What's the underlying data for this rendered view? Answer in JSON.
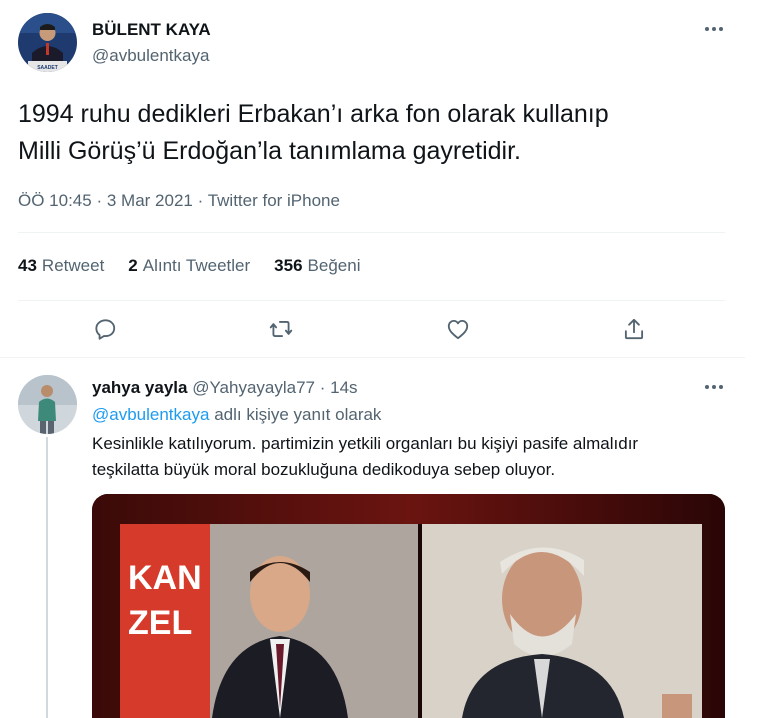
{
  "main_tweet": {
    "author_name": "BÜLENT KAYA",
    "author_handle": "@avbulentkaya",
    "text_line1": "1994 ruhu dedikleri Erbakan’ı arka fon olarak kullanıp",
    "text_line2": "Milli Görüş’ü Erdoğan’la tanımlama gayretidir.",
    "time": "ÖÖ 10:45",
    "date": "3 Mar 2021",
    "source": "Twitter for iPhone",
    "separator": "·",
    "avatar_badge": "SAADET",
    "stats": [
      {
        "count": "43",
        "label": "Retweet"
      },
      {
        "count": "2",
        "label": "Alıntı Tweetler"
      },
      {
        "count": "356",
        "label": "Beğeni"
      }
    ],
    "actions": [
      "reply-icon",
      "retweet-icon",
      "like-icon",
      "share-icon"
    ]
  },
  "reply_tweet": {
    "author_name": "yahya yayla",
    "author_handle": "@Yahyayayla77",
    "separator": "·",
    "time_ago": "14s",
    "reply_to_handle": "@avbulentkaya",
    "reply_to_suffix": "adlı kişiye yanıt olarak",
    "text_line1": "Kesinlikle katılıyorum. partimizin yetkili organları bu kişiyi pasife almalıdır",
    "text_line2": "teşkilatta büyük moral bozukluğuna dedikoduya sebep oluyor.",
    "media_caption_1": "KAN",
    "media_caption_2": "ZEL"
  },
  "colors": {
    "text_primary": "#0f1419",
    "text_secondary": "#536471",
    "link": "#1d9bf0",
    "divider": "#eff3f4"
  }
}
